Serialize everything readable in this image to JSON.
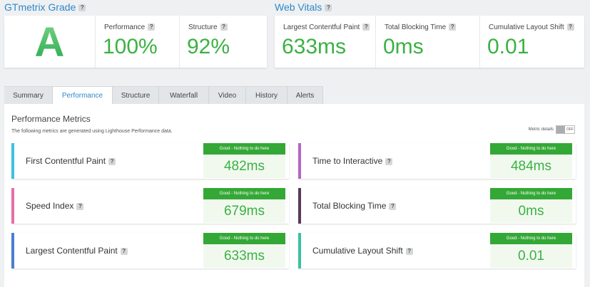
{
  "grade_section": {
    "title": "GTmetrix Grade",
    "help": "?",
    "letter": "A",
    "performance_label": "Performance",
    "performance_value": "100%",
    "structure_label": "Structure",
    "structure_value": "92%"
  },
  "web_vitals": {
    "title": "Web Vitals",
    "help": "?",
    "lcp_label": "Largest Contentful Paint",
    "lcp_value": "633ms",
    "tbt_label": "Total Blocking Time",
    "tbt_value": "0ms",
    "cls_label": "Cumulative Layout Shift",
    "cls_value": "0.01"
  },
  "tabs": [
    "Summary",
    "Performance",
    "Structure",
    "Waterfall",
    "Video",
    "History",
    "Alerts"
  ],
  "active_tab": "Performance",
  "panel": {
    "title": "Performance Metrics",
    "subtitle": "The following metrics are generated using Lighthouse Performance data.",
    "toggle_label": "Metric details",
    "toggle_state": "OFF"
  },
  "metrics": [
    {
      "label": "First Contentful Paint",
      "badge": "Good - Nothing to do here",
      "value": "482ms",
      "color": "#3fc0e8"
    },
    {
      "label": "Time to Interactive",
      "badge": "Good - Nothing to do here",
      "value": "484ms",
      "color": "#b565c6"
    },
    {
      "label": "Speed Index",
      "badge": "Good - Nothing to do here",
      "value": "679ms",
      "color": "#e66fa8"
    },
    {
      "label": "Total Blocking Time",
      "badge": "Good - Nothing to do here",
      "value": "0ms",
      "color": "#5a3a5a"
    },
    {
      "label": "Largest Contentful Paint",
      "badge": "Good - Nothing to do here",
      "value": "633ms",
      "color": "#4a7fd1"
    },
    {
      "label": "Cumulative Layout Shift",
      "badge": "Good - Nothing to do here",
      "value": "0.01",
      "color": "#3bc2a0"
    }
  ],
  "colors": {
    "accent_blue": "#2e88c9",
    "good_green": "#34a836",
    "value_green": "#3bb143"
  }
}
